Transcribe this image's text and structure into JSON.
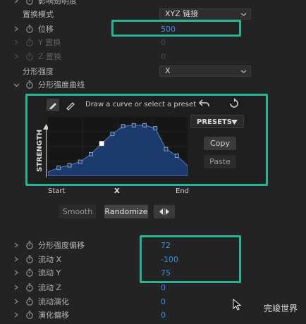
{
  "props": {
    "top_cut": "影响透明度",
    "displacement_mode": {
      "label": "置换模式",
      "value": "XYZ 链接"
    },
    "displacement": {
      "label": "位移",
      "value": "500"
    },
    "y_disp": {
      "label": "Y 置换",
      "value": "0"
    },
    "z_disp": {
      "label": "Z 置换",
      "value": "0"
    },
    "fractal_strength": {
      "label": "分形强度",
      "value": "X"
    },
    "strength_curve": {
      "label": "分形强度曲线"
    },
    "strength_offset": {
      "label": "分形强度偏移",
      "value": "72"
    },
    "flow_x": {
      "label": "流动 X",
      "value": "-100"
    },
    "flow_y": {
      "label": "流动 Y",
      "value": "75"
    },
    "flow_z": {
      "label": "流动 Z",
      "value": "0"
    },
    "flow_evolution": {
      "label": "流动演化",
      "value": "0"
    },
    "evolution_offset": {
      "label": "演化偏移",
      "value": "0"
    }
  },
  "curve_editor": {
    "hint": "Draw a curve or select a preset",
    "presets_label": "PRESETS",
    "copy_label": "Copy",
    "paste_label": "Paste",
    "strength_axis": "STRENGTH",
    "x_axis": "X",
    "start_label": "Start",
    "end_label": "End",
    "smooth_label": "Smooth",
    "randomize_label": "Randomize",
    "curve_points": [
      0.0,
      0.08,
      0.13,
      0.2,
      0.35,
      0.56,
      0.75,
      0.9,
      0.92,
      0.92,
      0.86,
      0.45,
      0.32,
      0.12
    ],
    "selected_point": 5,
    "fill_color": "#1c3a6c",
    "stroke_color": "#5280c8"
  },
  "watermark": "完竣世界",
  "colors": {
    "value_blue": "#3a8de6",
    "highlight": "#27b394"
  }
}
